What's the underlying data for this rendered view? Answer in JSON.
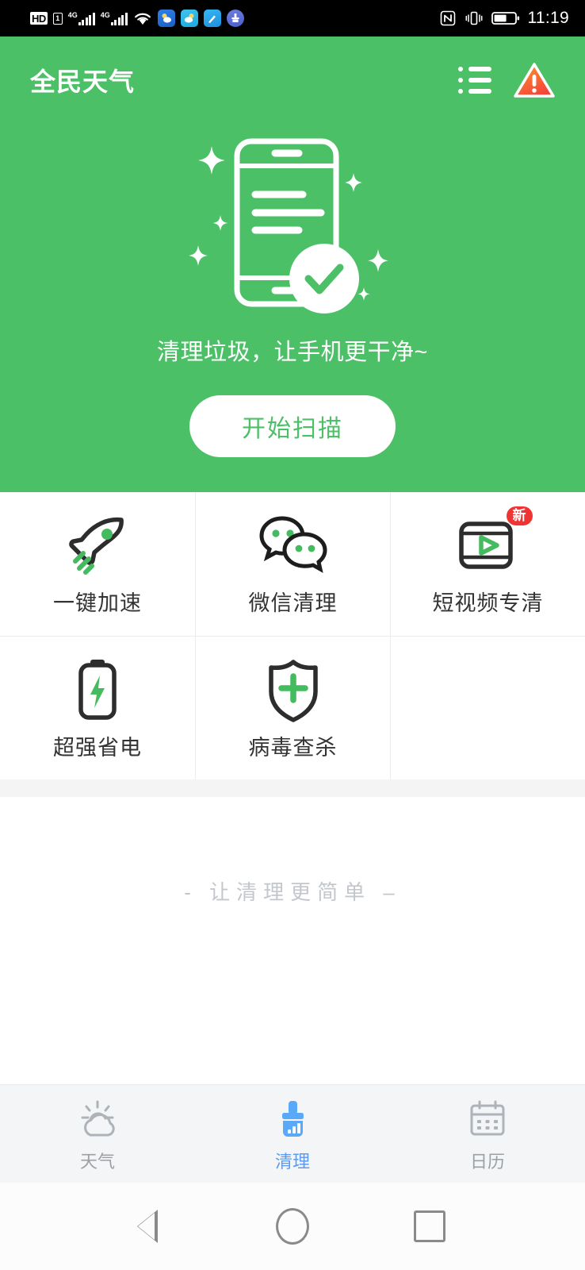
{
  "status_bar": {
    "hd_label": "HD",
    "sim_label": "1",
    "network_label_1": "4G",
    "network_label_2": "4G",
    "icons": [
      "hd-voice-icon",
      "sim-card-icon",
      "signal-4g-icon-1",
      "signal-4g-icon-2",
      "wifi-icon",
      "weather-app-icon",
      "weather-app-icon-2",
      "tools-app-icon",
      "cleaner-app-icon",
      "nfc-icon",
      "vibrate-icon",
      "battery-icon"
    ],
    "time": "11:19"
  },
  "app_bar": {
    "title": "全民天气",
    "menu_icon": "list-menu-icon",
    "warning_icon": "warning-triangle-icon"
  },
  "hero": {
    "illustration": "phone-clean-check-illustration",
    "tagline": "清理垃圾，让手机更干净~",
    "scan_button": "开始扫描",
    "background_color": "#4cc067",
    "button_text_color": "#4cc067"
  },
  "features": [
    {
      "label": "一键加速",
      "icon": "rocket-icon",
      "badge": null
    },
    {
      "label": "微信清理",
      "icon": "wechat-bubbles-icon",
      "badge": null
    },
    {
      "label": "短视频专清",
      "icon": "video-player-icon",
      "badge": "新"
    },
    {
      "label": "超强省电",
      "icon": "battery-bolt-icon",
      "badge": null
    },
    {
      "label": "病毒查杀",
      "icon": "shield-cross-icon",
      "badge": null
    }
  ],
  "slogan": "- 让清理更简单 –",
  "tab_bar": {
    "active_color": "#5b9bf3",
    "inactive_color": "#9ba0a6",
    "tabs": [
      {
        "label": "天气",
        "icon": "weather-sun-cloud-icon",
        "active": false
      },
      {
        "label": "清理",
        "icon": "broom-clean-icon",
        "active": true
      },
      {
        "label": "日历",
        "icon": "calendar-icon",
        "active": false
      }
    ]
  },
  "android_nav": {
    "back": "back-triangle-icon",
    "home": "home-circle-icon",
    "recents": "recents-square-icon"
  }
}
